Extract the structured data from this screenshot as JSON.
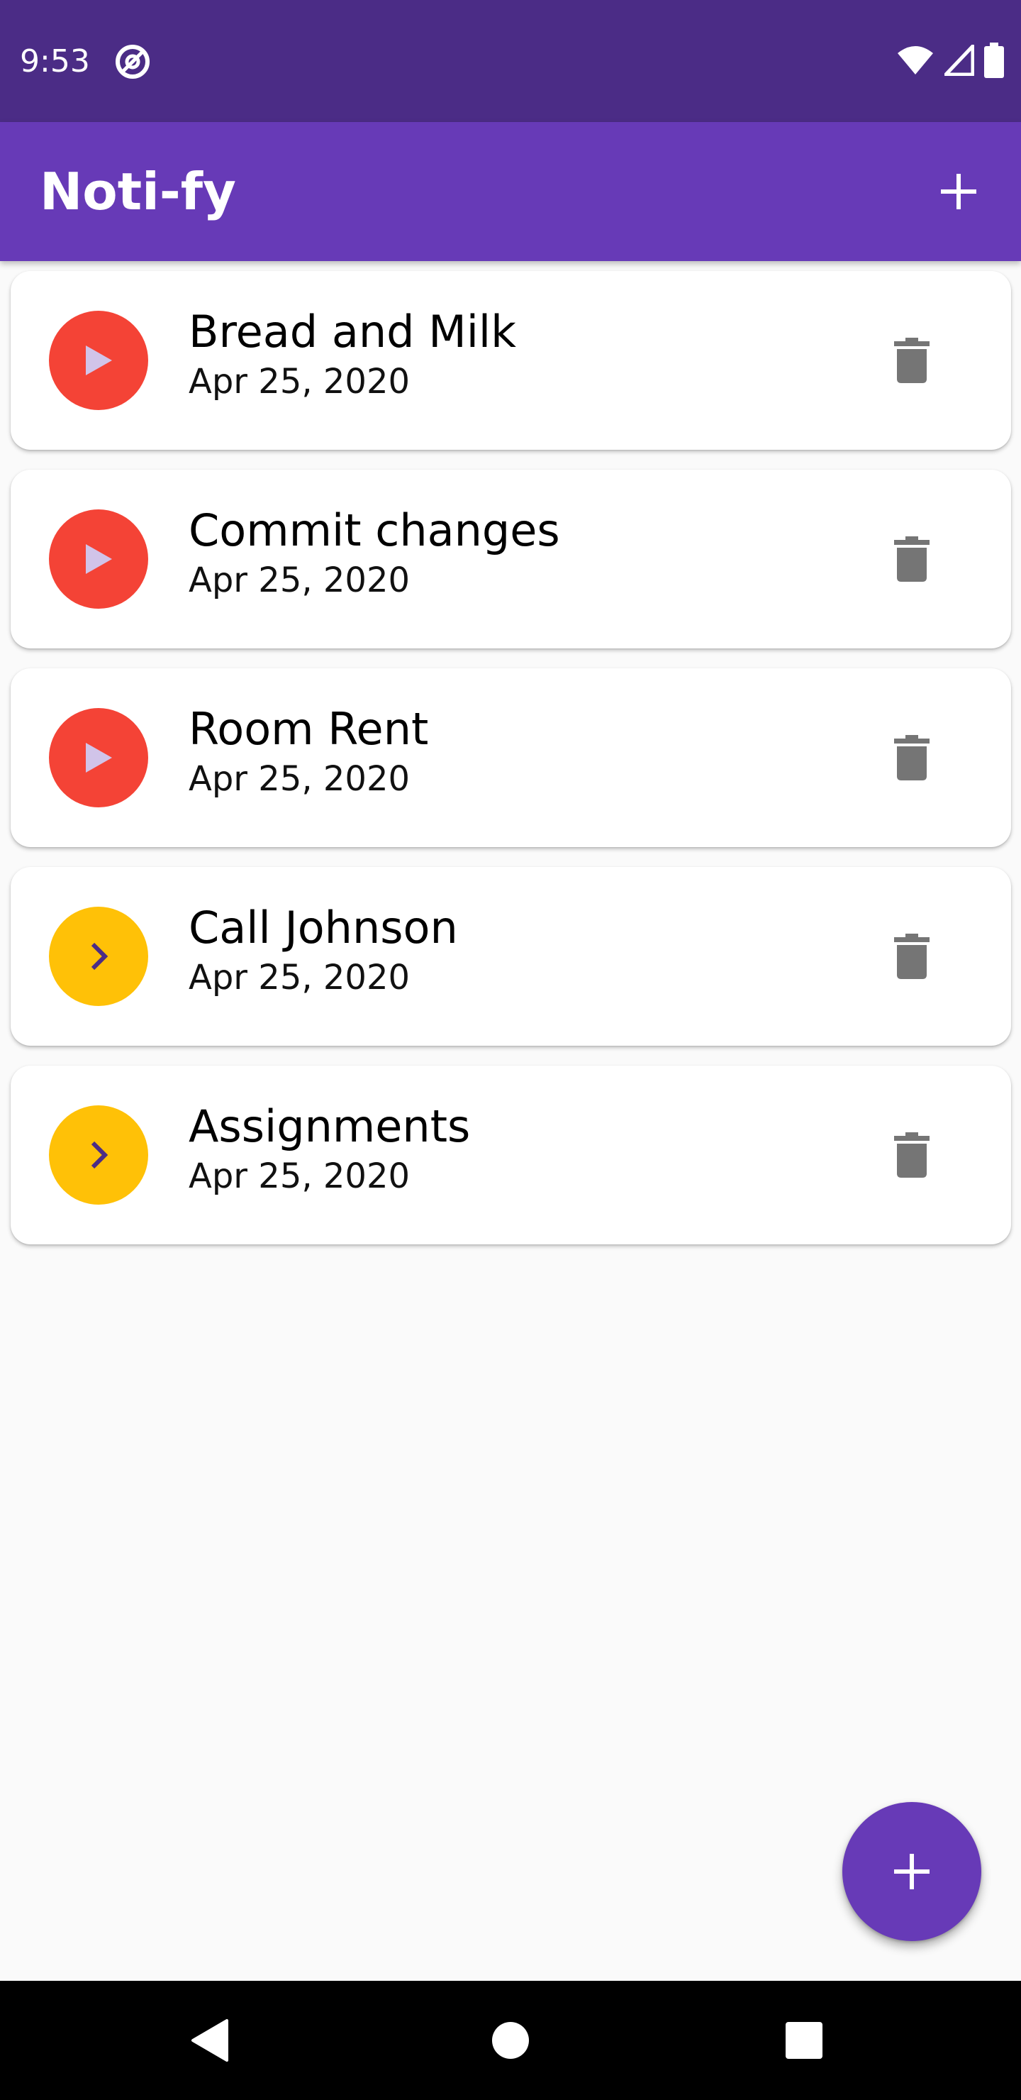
{
  "status_bar": {
    "time": "9:53",
    "app_icon": "sync-at-icon",
    "icons": [
      "wifi-icon",
      "cell-signal-icon",
      "battery-icon"
    ]
  },
  "app_bar": {
    "title": "Noti-fy",
    "action_icon": "add-icon"
  },
  "notes": [
    {
      "title": "Bread and Milk",
      "date": "Apr 25, 2020",
      "status_icon": "play-icon",
      "status_color": "#f44336",
      "icon_color": "#d1c4e9"
    },
    {
      "title": "Commit changes",
      "date": "Apr 25, 2020",
      "status_icon": "play-icon",
      "status_color": "#f44336",
      "icon_color": "#d1c4e9"
    },
    {
      "title": "Room Rent",
      "date": "Apr 25, 2020",
      "status_icon": "play-icon",
      "status_color": "#f44336",
      "icon_color": "#d1c4e9"
    },
    {
      "title": "Call Johnson",
      "date": "Apr 25, 2020",
      "status_icon": "chevron-right-icon",
      "status_color": "#ffc107",
      "icon_color": "#4b2c86"
    },
    {
      "title": "Assignments",
      "date": "Apr 25, 2020",
      "status_icon": "chevron-right-icon",
      "status_color": "#ffc107",
      "icon_color": "#4b2c86"
    }
  ],
  "fab": {
    "icon": "add-icon"
  },
  "nav_bar": {
    "buttons": [
      "back-icon",
      "home-icon",
      "recents-icon"
    ]
  },
  "colors": {
    "primary": "#673ab7",
    "primary_dark": "#4b2c86",
    "red": "#f44336",
    "amber": "#ffc107",
    "delete_icon": "#757575"
  }
}
